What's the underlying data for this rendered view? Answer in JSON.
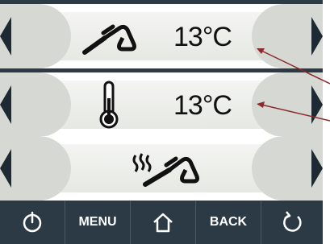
{
  "rows": [
    {
      "icon": "steam-wand-icon",
      "value": "13°C"
    },
    {
      "icon": "thermometer-icon",
      "value": "13°C"
    },
    {
      "icon": "heated-wand-icon",
      "value": ""
    }
  ],
  "bottom_bar": {
    "power_icon": "power-icon",
    "menu_label": "MENU",
    "home_icon": "home-icon",
    "back_label": "BACK",
    "refresh_icon": "refresh-icon"
  },
  "colors": {
    "panel_bg": "#f4f5f2",
    "cap": "#d6d8d3",
    "bar": "#2b3a44",
    "annotation_arrow": "#8b2a2a"
  }
}
